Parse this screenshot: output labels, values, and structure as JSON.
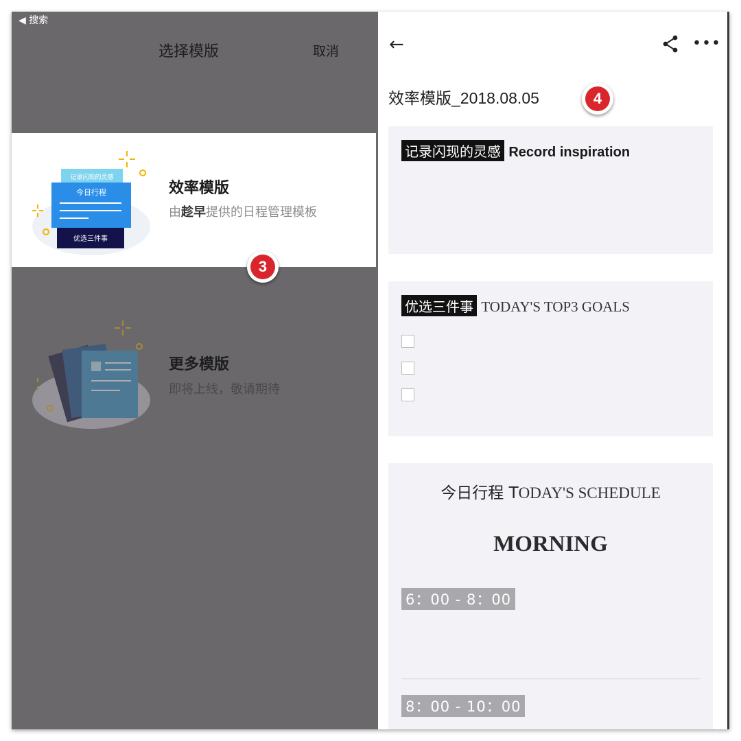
{
  "status_bar": {
    "back_label": "◀ 搜索"
  },
  "nav": {
    "title": "选择模版",
    "cancel": "取消"
  },
  "templates": [
    {
      "name": "效率模版",
      "subtitle_prefix": "由",
      "subtitle_author": "趁早",
      "subtitle_suffix": "提供的日程管理模板",
      "illustration_labels": [
        "记录闪现的灵感",
        "今日行程",
        "优选三件事"
      ]
    },
    {
      "name": "更多模版",
      "subtitle": "即将上线，敬请期待"
    }
  ],
  "annotations": {
    "step_left": "3",
    "step_right": "4"
  },
  "preview": {
    "back_icon": "arrow-left-icon",
    "share_icon": "share-icon",
    "more_icon": "more-icon",
    "doc_title": "效率模版_2018.08.05",
    "inspiration": {
      "tag": "记录闪现的灵感",
      "label": "Record inspiration"
    },
    "goals": {
      "tag": "优选三件事",
      "label": "TODAY'S TOP3 GOALS",
      "checkbox_count": 3
    },
    "schedule": {
      "title_cn": "今日行程",
      "title_en_first": "T",
      "title_en_rest": "ODAY'S SCHEDULE",
      "period": "MORNING",
      "slots": [
        "6：00 - 8：00",
        "8：00 - 10：00"
      ]
    }
  },
  "colors": {
    "dim_overlay": "#6a686b",
    "badge_red": "#d9262c",
    "panel_bg": "#f3f2f7",
    "illus_blue": "#2a8ee8"
  }
}
